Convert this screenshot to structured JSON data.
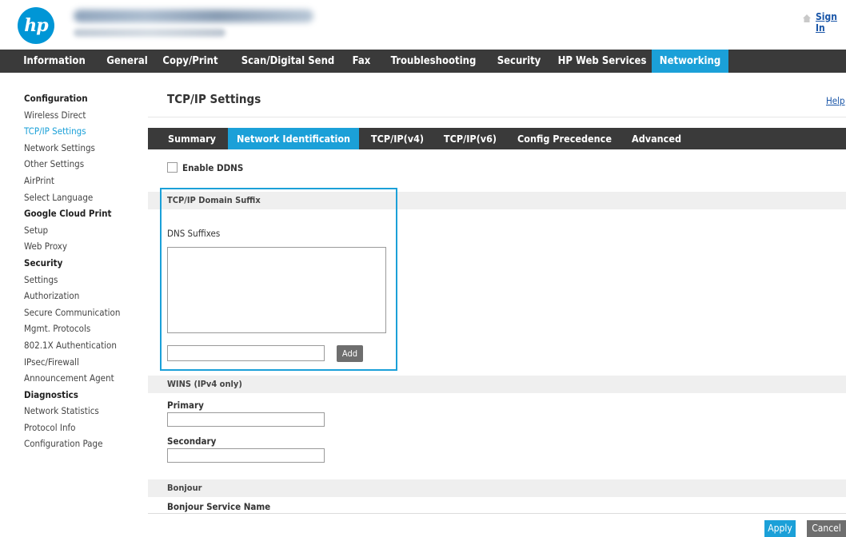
{
  "header": {
    "logo_text": "hp",
    "signin_label": "Sign In"
  },
  "main_nav": {
    "tabs": [
      {
        "label": "Information"
      },
      {
        "label": "General"
      },
      {
        "label": "Copy/Print"
      },
      {
        "label": "Scan/Digital Send"
      },
      {
        "label": "Fax"
      },
      {
        "label": "Troubleshooting"
      },
      {
        "label": "Security"
      },
      {
        "label": "HP Web Services"
      },
      {
        "label": "Networking",
        "active": true
      }
    ]
  },
  "sidebar": {
    "items": [
      {
        "label": "Configuration",
        "type": "heading"
      },
      {
        "label": "Wireless Direct"
      },
      {
        "label": "TCP/IP Settings",
        "active": true
      },
      {
        "label": "Network Settings"
      },
      {
        "label": "Other Settings"
      },
      {
        "label": "AirPrint"
      },
      {
        "label": "Select Language"
      },
      {
        "label": "Google Cloud Print",
        "type": "heading"
      },
      {
        "label": "Setup"
      },
      {
        "label": "Web Proxy"
      },
      {
        "label": "Security",
        "type": "heading"
      },
      {
        "label": "Settings"
      },
      {
        "label": "Authorization"
      },
      {
        "label": "Secure Communication"
      },
      {
        "label": "Mgmt. Protocols"
      },
      {
        "label": "802.1X Authentication"
      },
      {
        "label": "IPsec/Firewall"
      },
      {
        "label": "Announcement Agent"
      },
      {
        "label": "Diagnostics",
        "type": "heading"
      },
      {
        "label": "Network Statistics"
      },
      {
        "label": "Protocol Info"
      },
      {
        "label": "Configuration Page"
      }
    ]
  },
  "content": {
    "title": "TCP/IP Settings",
    "help_label": "Help",
    "subtabs": [
      {
        "label": "Summary"
      },
      {
        "label": "Network Identification",
        "active": true
      },
      {
        "label": "TCP/IP(v4)"
      },
      {
        "label": "TCP/IP(v6)"
      },
      {
        "label": "Config Precedence"
      },
      {
        "label": "Advanced"
      }
    ],
    "enable_ddns_label": "Enable DDNS",
    "enable_ddns_checked": false,
    "domain_suffix": {
      "section_label": "TCP/IP Domain Suffix",
      "dns_suffixes_label": "DNS Suffixes",
      "suffix_input_value": "",
      "add_label": "Add"
    },
    "wins": {
      "section_label": "WINS (IPv4 only)",
      "primary_label": "Primary",
      "primary_value": "",
      "secondary_label": "Secondary",
      "secondary_value": ""
    },
    "bonjour": {
      "section_label": "Bonjour",
      "service_name_label": "Bonjour Service Name"
    },
    "apply_label": "Apply",
    "cancel_label": "Cancel"
  },
  "colors": {
    "accent": "#1ba0d8",
    "nav_background": "#3a3a3a",
    "hp_blue": "#0096d6",
    "link": "#1a56a8"
  },
  "icons": [
    "hp-logo",
    "home-icon"
  ]
}
